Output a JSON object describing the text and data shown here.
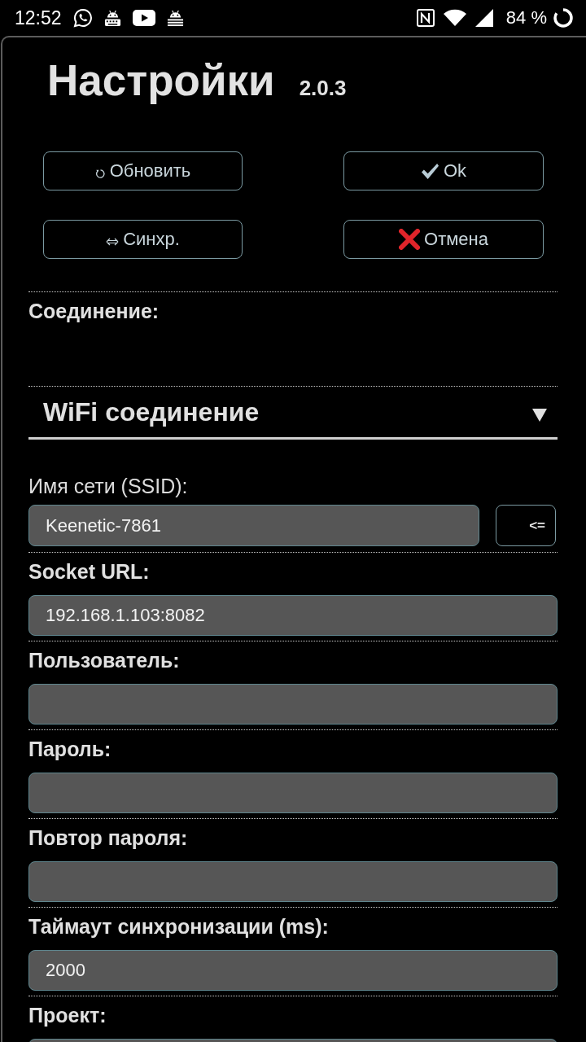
{
  "status_bar": {
    "time": "12:52",
    "battery": "84 %"
  },
  "dialog": {
    "title": "Настройки",
    "version": "2.0.3",
    "buttons": [
      {
        "label": "Обновить"
      },
      {
        "label": "Ok"
      },
      {
        "label": "Синхр."
      },
      {
        "label": "Отмена"
      }
    ],
    "connection": {
      "label": "Соединение:",
      "dropdown": "WiFi соединение"
    },
    "fields": [
      {
        "kind": "ssid",
        "label": "Имя сети (SSID):",
        "value": "Keenetic-7861",
        "button": "<="
      },
      {
        "kind": "text",
        "label": "Socket URL:",
        "value": "192.168.1.103:8082"
      },
      {
        "kind": "text",
        "label": "Пользователь:"
      },
      {
        "kind": "text",
        "label": "Пароль:"
      },
      {
        "kind": "text",
        "label": "Повтор пароля:"
      },
      {
        "kind": "text",
        "label": "Таймаут синхронизации (ms):",
        "value": "2000"
      },
      {
        "kind": "text",
        "label": "Проект:"
      }
    ]
  }
}
